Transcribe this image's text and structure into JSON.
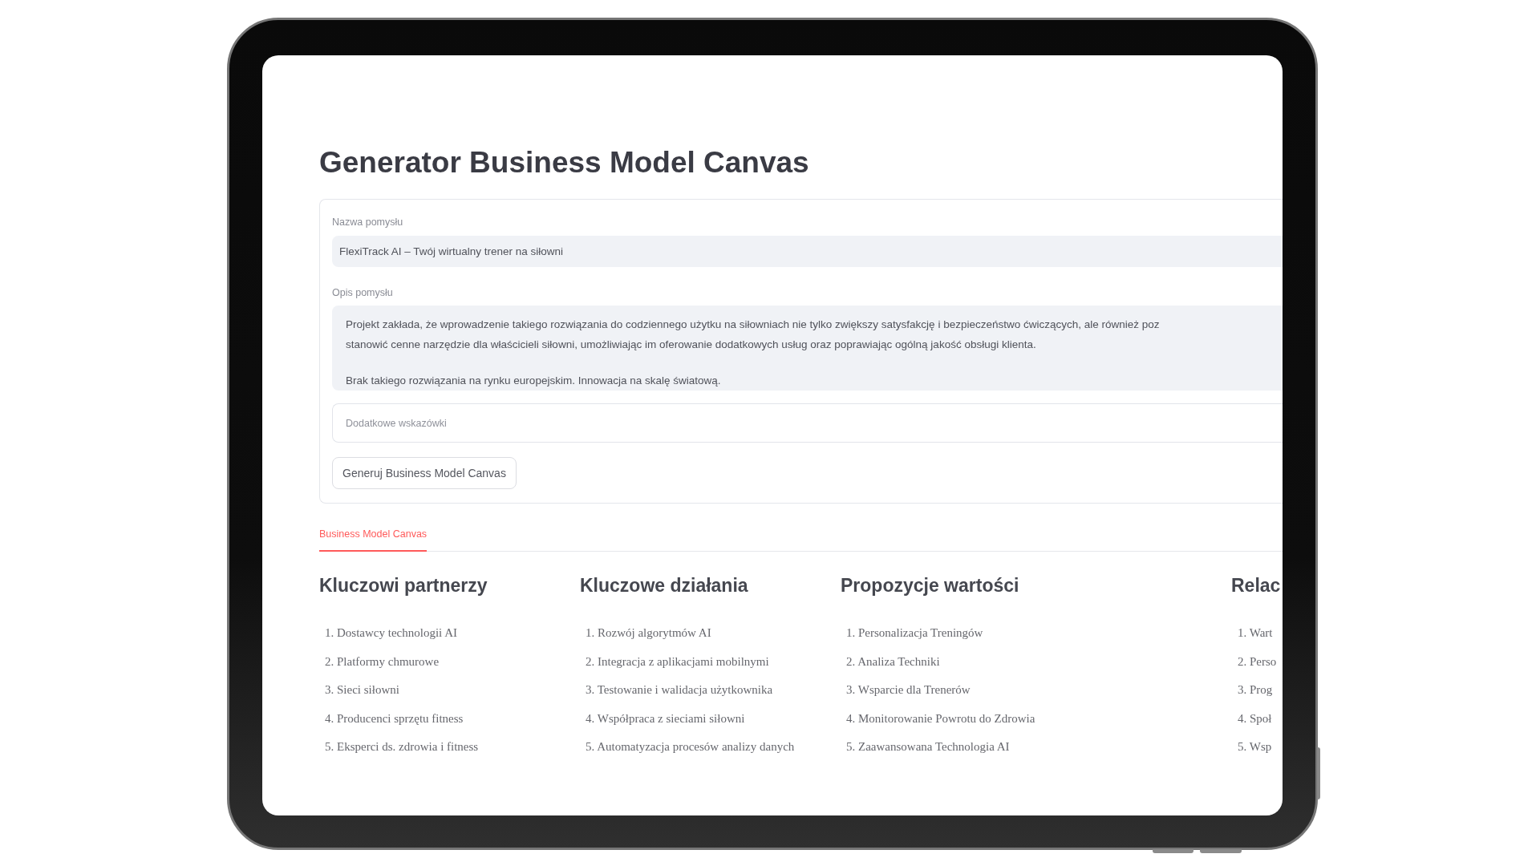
{
  "page": {
    "title": "Generator Business Model Canvas"
  },
  "form": {
    "name_field": {
      "label": "Nazwa pomysłu",
      "value": "FlexiTrack AI – Twój wirtualny trener na siłowni"
    },
    "description_field": {
      "label": "Opis pomysłu",
      "paragraphs": [
        [
          "Projekt zakłada, że wprowadzenie takiego rozwiązania do codziennego użytku na siłowniach nie tylko zwiększy satysfakcję i bezpieczeństwo ćwiczących, ale również poz",
          "stanowić cenne narzędzie dla właścicieli siłowni, umożliwiając im oferowanie dodatkowych usług oraz poprawiając ogólną jakość obsługi klienta."
        ],
        [
          "Brak takiego rozwiązania na rynku europejskim. Innowacja na skalę światową."
        ]
      ]
    },
    "hints_field": {
      "placeholder": "Dodatkowe wskazówki"
    },
    "button": {
      "label": "Generuj Business Model Canvas"
    }
  },
  "tabs": [
    {
      "label": "Business Model Canvas",
      "selected": true
    }
  ],
  "canvas": {
    "sections": [
      {
        "heading": "Kluczowi partnerzy",
        "items": [
          "1. Dostawcy technologii AI",
          "2. Platformy chmurowe",
          "3. Sieci siłowni",
          "4. Producenci sprzętu fitness",
          "5. Eksperci ds. zdrowia i fitness"
        ]
      },
      {
        "heading": "Kluczowe działania",
        "items": [
          "1. Rozwój algorytmów AI",
          "2. Integracja z aplikacjami mobilnymi",
          "3. Testowanie i walidacja użytkownika",
          "4. Współpraca z sieciami siłowni",
          "5. Automatyzacja procesów analizy danych"
        ]
      },
      {
        "heading": "Propozycje wartości",
        "items": [
          "1. Personalizacja Treningów",
          "2. Analiza Techniki",
          "3. Wsparcie dla Trenerów",
          "4. Monitorowanie Powrotu do Zdrowia",
          "5. Zaawansowana Technologia AI"
        ]
      },
      {
        "heading": "Relac",
        "items": [
          "1. Wart",
          "2. Perso",
          "3. Prog",
          "4. Społ",
          "5. Wsp"
        ]
      }
    ]
  }
}
